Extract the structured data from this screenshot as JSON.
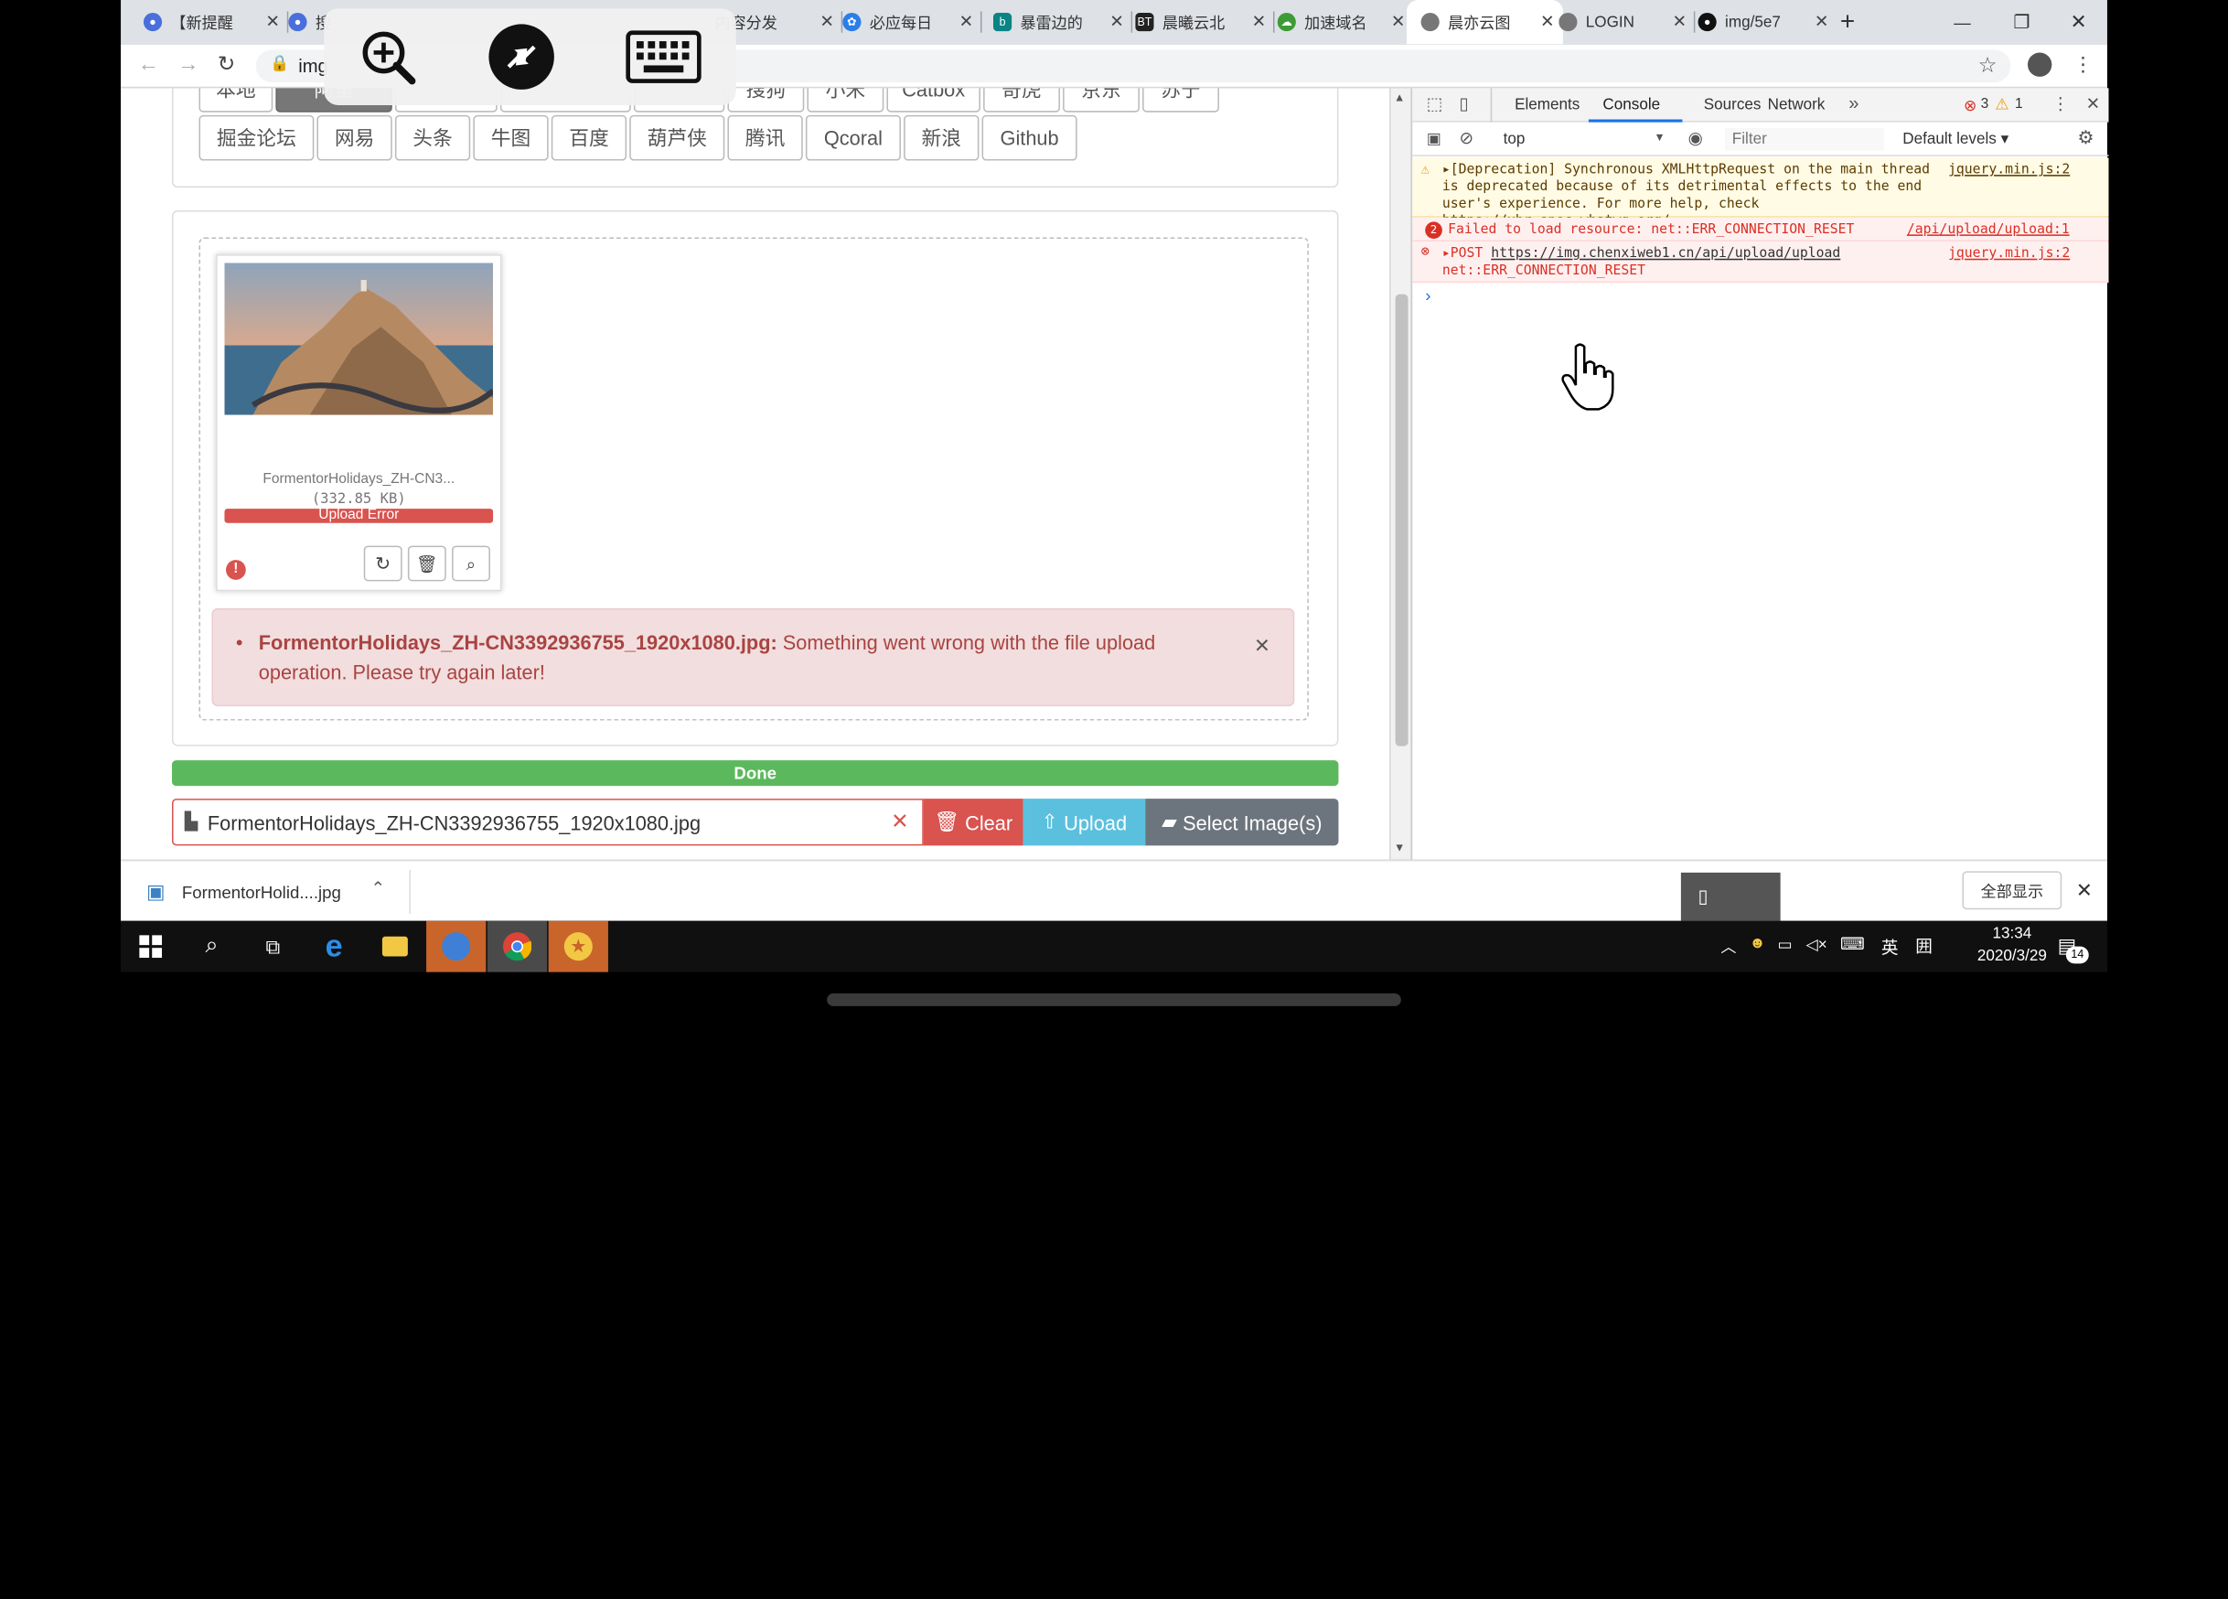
{
  "browser": {
    "tabs": [
      {
        "label": "【新提醒",
        "color": "#4a6fdc"
      },
      {
        "label": "搜",
        "color": "#4a6fdc"
      },
      {
        "label": "内容分发",
        "color": "#4a6fdc"
      },
      {
        "label": "必应每日",
        "color": "#2b7de9"
      },
      {
        "label": "暴雷边的",
        "color": "#0c8484"
      },
      {
        "label": "晨曦云北",
        "color": "#222222"
      },
      {
        "label": "加速域名",
        "color": "#3d9b35"
      },
      {
        "label": "晨亦云图",
        "color": "#777777"
      },
      {
        "label": "LOGIN",
        "color": "#777777"
      },
      {
        "label": "img/5e7",
        "color": "#111111"
      }
    ],
    "favicon_texts": [
      "BT"
    ],
    "new_tab": "+",
    "address": "img",
    "window_controls": {
      "minimize": "—",
      "restore": "❐",
      "close": "✕"
    }
  },
  "remote_toolbar": {
    "zoom": "zoom-in-icon",
    "remote": "remote-desktop-icon",
    "keyboard": "keyboard-icon"
  },
  "page": {
    "sources_row1": [
      "本地",
      "阿里",
      "",
      "",
      "",
      "搜狗",
      "小米",
      "Catbox",
      "奇虎",
      "京东",
      "苏宁"
    ],
    "sources_row2": [
      "掘金论坛",
      "网易",
      "头条",
      "牛图",
      "百度",
      "葫芦侠",
      "腾讯",
      "Qcoral",
      "新浪",
      "Github"
    ],
    "file": {
      "caption": "FormentorHolidays_ZH-CN3...",
      "size": "(332.85 KB)",
      "status": "Upload Error"
    },
    "alert": {
      "filename": "FormentorHolidays_ZH-CN3392936755_1920x1080.jpg:",
      "message": "Something went wrong with the file upload operation. Please try again later!",
      "close": "×"
    },
    "progress": {
      "label": "Done",
      "value": 100
    },
    "input": {
      "value": "FormentorHolidays_ZH-CN3392936755_1920x1080.jpg",
      "clear": "Clear",
      "upload": "Upload",
      "select": "Select Image(s)"
    }
  },
  "devtools": {
    "tabs": [
      "Elements",
      "Console",
      "Sources",
      "Network"
    ],
    "active_tab": "Console",
    "error_count": "3",
    "warning_count": "1",
    "context": "top",
    "filter_placeholder": "Filter",
    "levels": "Default levels ▾",
    "messages": [
      {
        "type": "warning",
        "text": "▸[Deprecation] Synchronous XMLHttpRequest on the main thread is deprecated because of its detrimental effects to the end user's experience. For more help, check ",
        "link": "https://xhr.spec.whatwg.org/",
        "source": "jquery.min.js:2"
      },
      {
        "type": "error",
        "badge": "2",
        "text": "Failed to load resource: net::ERR_CONNECTION_RESET",
        "source": "/api/upload/upload:1"
      },
      {
        "type": "error",
        "text": "▸POST ",
        "link": "https://img.chenxiweb1.cn/api/upload/upload",
        "text2": "net::ERR_CONNECTION_RESET",
        "source": "jquery.min.js:2"
      }
    ],
    "prompt": "›"
  },
  "downloads": {
    "file": "FormentorHolid....jpg",
    "show_all": "全部显示",
    "close": "✕"
  },
  "taskbar": {
    "time": "13:34",
    "date": "2020/3/29",
    "ime": "英",
    "notifications": "14"
  }
}
